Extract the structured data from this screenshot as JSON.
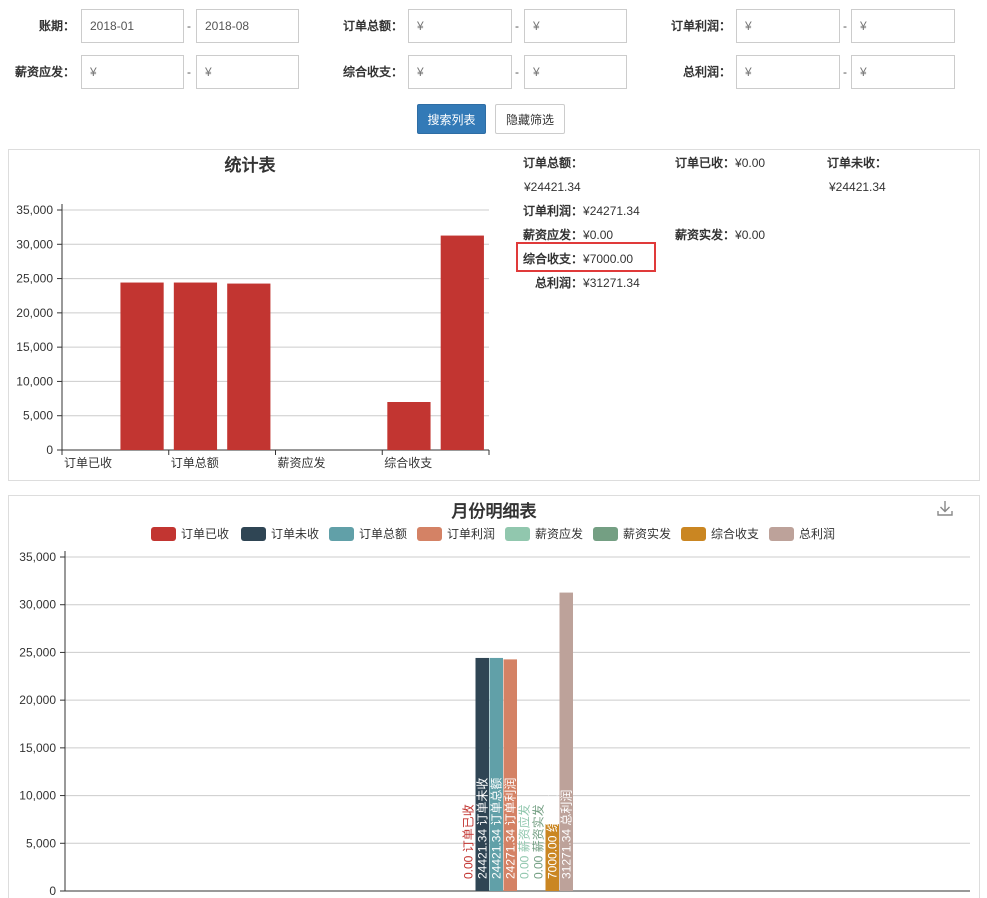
{
  "filters": {
    "row1": [
      {
        "label": "账期：",
        "from": "2018-01",
        "to": "2018-08",
        "from_placeholder": "",
        "to_placeholder": ""
      },
      {
        "label": "订单总额：",
        "from": "",
        "to": "",
        "from_placeholder": "¥",
        "to_placeholder": "¥"
      },
      {
        "label": "订单利润：",
        "from": "",
        "to": "",
        "from_placeholder": "¥",
        "to_placeholder": "¥"
      }
    ],
    "row2": [
      {
        "label": "薪资应发：",
        "from": "",
        "to": "",
        "from_placeholder": "¥",
        "to_placeholder": "¥"
      },
      {
        "label": "综合收支：",
        "from": "",
        "to": "",
        "from_placeholder": "¥",
        "to_placeholder": "¥"
      },
      {
        "label": "总利润：",
        "from": "",
        "to": "",
        "from_placeholder": "¥",
        "to_placeholder": "¥"
      }
    ],
    "dash": "-"
  },
  "buttons": {
    "search": "搜索列表",
    "hide": "隐藏筛选"
  },
  "summary": {
    "order_total_label": "订单总额：",
    "order_total_value": "¥24421.34",
    "order_received_label": "订单已收：",
    "order_received_value": "¥0.00",
    "order_unreceived_label": "订单未收：",
    "order_unreceived_value": "¥24421.34",
    "order_profit_label": "订单利润：",
    "order_profit_value": "¥24271.34",
    "salary_due_label": "薪资应发：",
    "salary_due_value": "¥0.00",
    "salary_paid_label": "薪资实发：",
    "salary_paid_value": "¥0.00",
    "combined_label": "综合收支：",
    "combined_value": "¥7000.00",
    "total_profit_label": "总利润：",
    "total_profit_value": "¥31271.34"
  },
  "colors": {
    "bar_red": "#c23531",
    "highlight": "#e03a3a",
    "primary": "#337ab7",
    "series": [
      "#c23531",
      "#2f4554",
      "#61a0a8",
      "#d48265",
      "#91c7ae",
      "#749f83",
      "#ca8622",
      "#bda29a"
    ]
  },
  "download_icon": "download-icon",
  "chart_data": [
    {
      "type": "bar",
      "title": "统计表",
      "categories": [
        "订单已收",
        "订单未收",
        "订单总额",
        "订单利润",
        "薪资应发",
        "薪资实发",
        "综合收支",
        "总利润"
      ],
      "values": [
        0,
        24421.34,
        24421.34,
        24271.34,
        0,
        0,
        7000,
        31271.34
      ],
      "x_tick_labels": [
        "订单已收",
        "订单总额",
        "薪资应发",
        "综合收支"
      ],
      "y_ticks": [
        "0",
        "5,000",
        "10,000",
        "15,000",
        "20,000",
        "25,000",
        "30,000",
        "35,000"
      ],
      "ylim": [
        0,
        35000
      ],
      "grid": true
    },
    {
      "type": "bar",
      "title": "月份明细表",
      "legend_position": "top",
      "series": [
        {
          "name": "订单已收",
          "values": [
            0
          ],
          "labels": [
            "0.00 订单已收"
          ]
        },
        {
          "name": "订单未收",
          "values": [
            24421.34
          ],
          "labels": [
            "24421.34 订单未收"
          ]
        },
        {
          "name": "订单总额",
          "values": [
            24421.34
          ],
          "labels": [
            "24421.34 订单总额"
          ]
        },
        {
          "name": "订单利润",
          "values": [
            24271.34
          ],
          "labels": [
            "24271.34 订单利润"
          ]
        },
        {
          "name": "薪资应发",
          "values": [
            0
          ],
          "labels": [
            "0.00 薪资应发"
          ]
        },
        {
          "name": "薪资实发",
          "values": [
            0
          ],
          "labels": [
            "0.00 薪资实发"
          ]
        },
        {
          "name": "综合收支",
          "values": [
            7000
          ],
          "labels": [
            "7000.00 综合收支"
          ]
        },
        {
          "name": "总利润",
          "values": [
            31271.34
          ],
          "labels": [
            "31271.34 总利润"
          ]
        }
      ],
      "y_ticks": [
        "0",
        "5,000",
        "10,000",
        "15,000",
        "20,000",
        "25,000",
        "30,000",
        "35,000"
      ],
      "ylim": [
        0,
        35000
      ],
      "grid": true
    }
  ]
}
